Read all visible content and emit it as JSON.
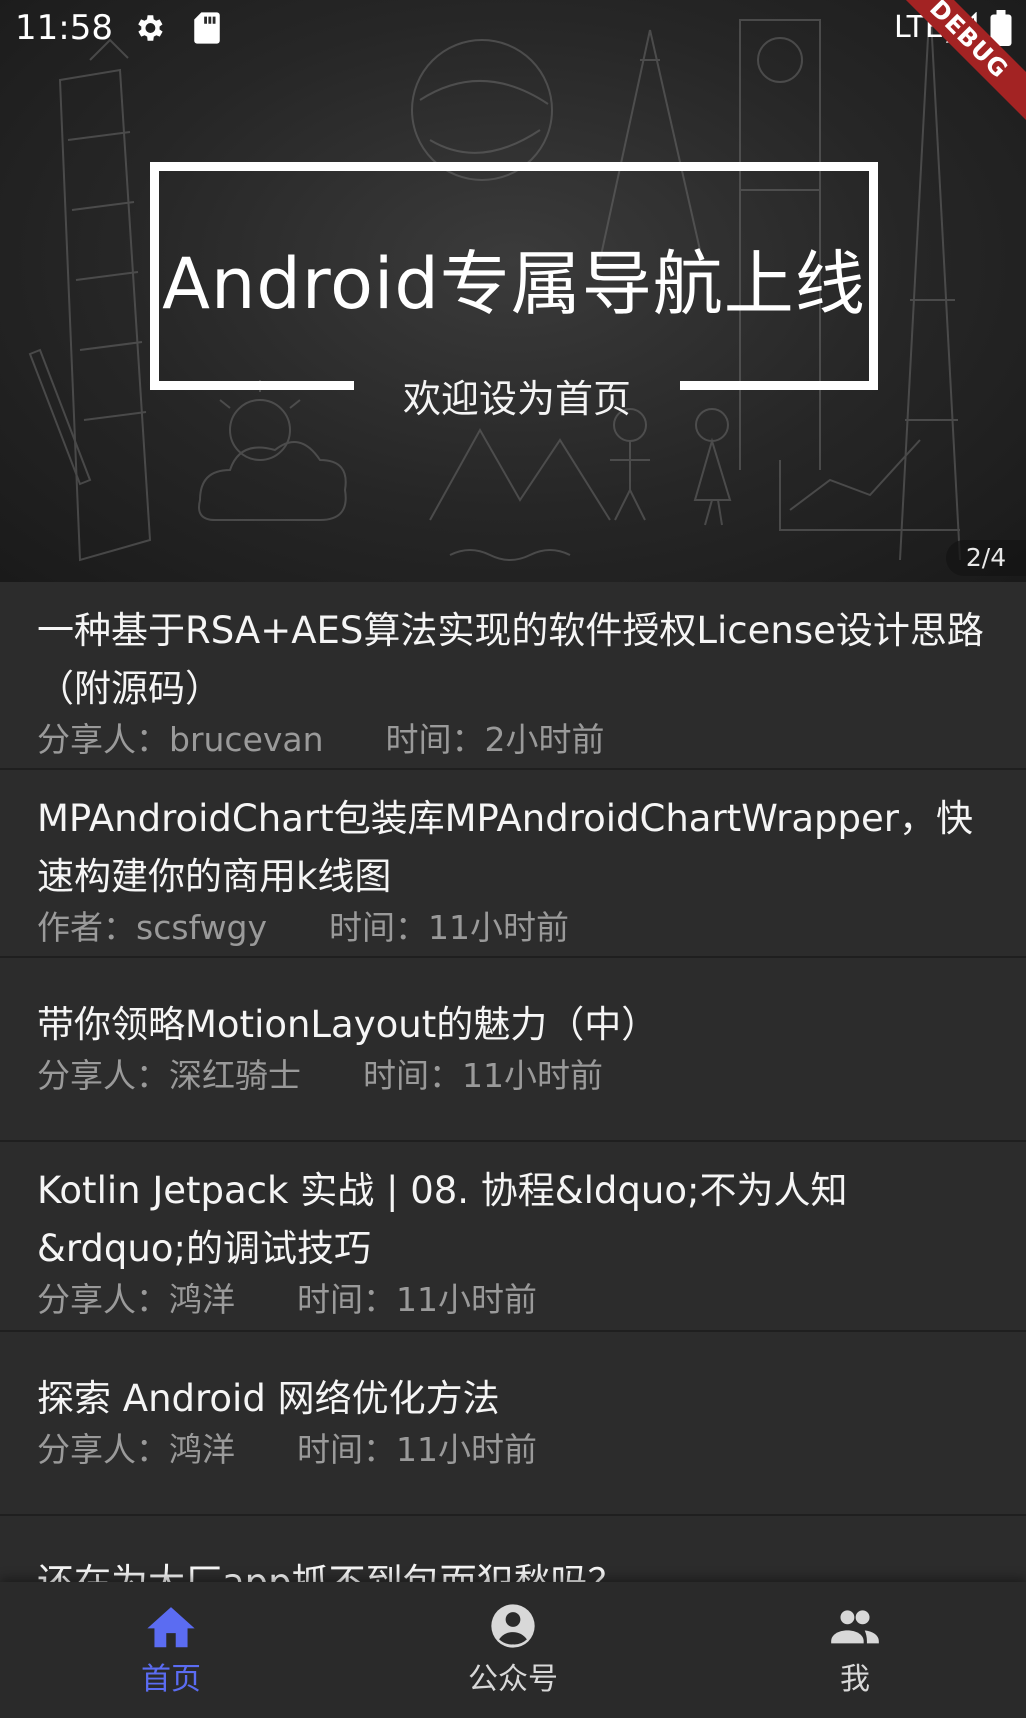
{
  "status_bar": {
    "time": "11:58",
    "network": "LTE",
    "icons": [
      "gear-icon",
      "sd-card-icon",
      "signal-icon",
      "battery-icon"
    ]
  },
  "debug_banner": "DEBUG",
  "banner": {
    "title": "Android专属导航上线",
    "subtitle": "欢迎设为首页",
    "page_indicator": "2/4"
  },
  "articles": [
    {
      "title": "一种基于RSA+AES算法实现的软件授权License设计思路（附源码）",
      "author": "分享人：brucevan",
      "time": "时间：2小时前"
    },
    {
      "title": "MPAndroidChart包装库MPAndroidChartWrapper，快速构建你的商用k线图",
      "author": "作者：scsfwgy",
      "time": "时间：11小时前"
    },
    {
      "title": "带你领略MotionLayout的魅力（中）",
      "author": "分享人：深红骑士",
      "time": "时间：11小时前"
    },
    {
      "title": "Kotlin Jetpack 实战 | 08. 协程&ldquo;不为人知&rdquo;的调试技巧",
      "author": "分享人：鸿洋",
      "time": "时间：11小时前"
    },
    {
      "title": "探索 Android 网络优化方法",
      "author": "分享人：鸿洋",
      "time": "时间：11小时前"
    },
    {
      "title": "还在为大厂app抓不到包而犯愁吗？",
      "author": "",
      "time": ""
    }
  ],
  "bottom_nav": {
    "items": [
      {
        "label": "首页",
        "icon": "home-icon",
        "active": true
      },
      {
        "label": "公众号",
        "icon": "account-circle-icon",
        "active": false
      },
      {
        "label": "我",
        "icon": "people-icon",
        "active": false
      }
    ]
  },
  "colors": {
    "accent": "#5b6cf2",
    "background": "#2c2c2c",
    "meta_text": "#9a9a9a",
    "debug": "#a32323"
  }
}
